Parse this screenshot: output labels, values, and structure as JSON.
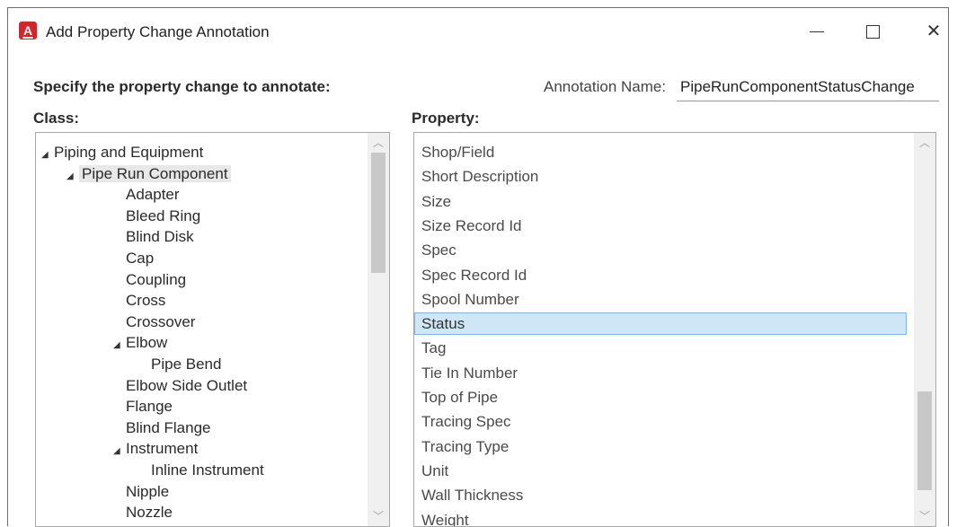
{
  "window": {
    "title": "Add Property Change Annotation",
    "app_icon_letter": "A",
    "minimize_symbol": "—",
    "maximize_symbol": "☐",
    "close_symbol": "✕"
  },
  "form": {
    "instruction": "Specify the property change to annotate:",
    "annotation_name_label": "Annotation Name:",
    "annotation_name_value": "PipeRunComponentStatusChange",
    "class_label": "Class:",
    "property_label": "Property:"
  },
  "class_tree": [
    {
      "label": "Piping and Equipment",
      "level": 0,
      "expanded": true
    },
    {
      "label": "Pipe Run Component",
      "level": 1,
      "expanded": true,
      "highlighted": true
    },
    {
      "label": "Adapter",
      "level": 2
    },
    {
      "label": "Bleed Ring",
      "level": 2
    },
    {
      "label": "Blind Disk",
      "level": 2
    },
    {
      "label": "Cap",
      "level": 2
    },
    {
      "label": "Coupling",
      "level": 2
    },
    {
      "label": "Cross",
      "level": 2
    },
    {
      "label": "Crossover",
      "level": 2
    },
    {
      "label": "Elbow",
      "level": 2,
      "expanded": true
    },
    {
      "label": "Pipe Bend",
      "level": 3
    },
    {
      "label": "Elbow Side Outlet",
      "level": 2
    },
    {
      "label": "Flange",
      "level": 2
    },
    {
      "label": "Blind Flange",
      "level": 2
    },
    {
      "label": "Instrument",
      "level": 2,
      "expanded": true
    },
    {
      "label": "Inline Instrument",
      "level": 3
    },
    {
      "label": "Nipple",
      "level": 2
    },
    {
      "label": "Nozzle",
      "level": 2
    }
  ],
  "properties": [
    {
      "label": "Shop/Field"
    },
    {
      "label": "Short Description"
    },
    {
      "label": "Size"
    },
    {
      "label": "Size Record Id"
    },
    {
      "label": "Spec"
    },
    {
      "label": "Spec Record Id"
    },
    {
      "label": "Spool Number"
    },
    {
      "label": "Status",
      "selected": true
    },
    {
      "label": "Tag"
    },
    {
      "label": "Tie In Number"
    },
    {
      "label": "Top of Pipe"
    },
    {
      "label": "Tracing Spec"
    },
    {
      "label": "Tracing Type"
    },
    {
      "label": "Unit"
    },
    {
      "label": "Wall Thickness"
    },
    {
      "label": "Weight"
    }
  ],
  "colors": {
    "selection_bg": "#cfe6f7",
    "selection_border": "#7fb6e6",
    "app_icon": "#d3262b"
  }
}
